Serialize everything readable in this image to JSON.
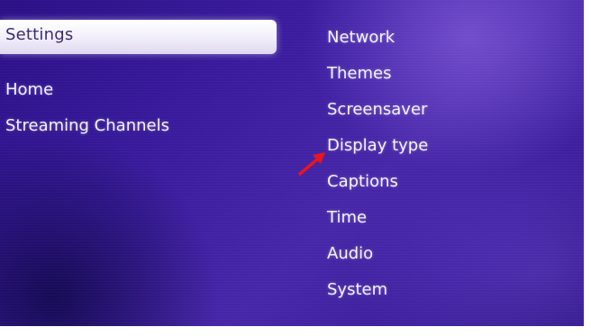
{
  "menu": {
    "selected_label": "Settings",
    "left_items": [
      {
        "label": "Home"
      },
      {
        "label": "Streaming Channels"
      }
    ]
  },
  "settings_submenu": {
    "items": [
      {
        "label": "Network"
      },
      {
        "label": "Themes"
      },
      {
        "label": "Screensaver"
      },
      {
        "label": "Display type"
      },
      {
        "label": "Captions"
      },
      {
        "label": "Time"
      },
      {
        "label": "Audio"
      },
      {
        "label": "System"
      }
    ]
  },
  "annotation": {
    "arrow_color": "#e8141c",
    "points_to": "Display type"
  },
  "colors": {
    "background": "#3a1c9e",
    "selected_bar": "#f1eefa",
    "text": "#f4f2ff"
  }
}
